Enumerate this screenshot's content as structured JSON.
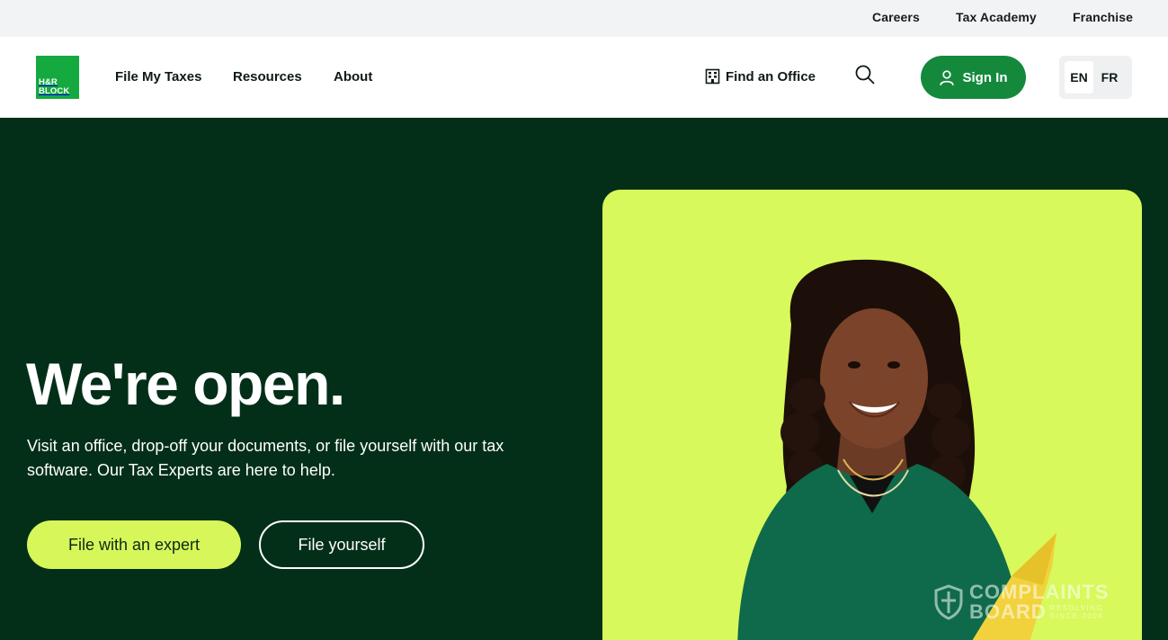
{
  "utility_nav": [
    "Careers",
    "Tax Academy",
    "Franchise"
  ],
  "brand": {
    "logo_line1": "H&R",
    "logo_line2": "BLOCK",
    "color": "#14aa40"
  },
  "main_nav": [
    "File My Taxes",
    "Resources",
    "About"
  ],
  "header": {
    "find_office": "Find an Office",
    "find_office_icon": "building-icon",
    "search_icon": "search-icon",
    "sign_in": "Sign In",
    "sign_in_icon": "user-icon"
  },
  "language": {
    "options": [
      "EN",
      "FR"
    ],
    "selected": "EN"
  },
  "hero": {
    "title": "We're open.",
    "subtitle": "Visit an office, drop-off your documents, or file yourself with our tax software. Our Tax Experts are here to help.",
    "primary_cta": "File with an expert",
    "secondary_cta": "File yourself"
  },
  "watermark": {
    "line1": "COMPLAINTS",
    "line2": "BOARD",
    "tag1": "RESOLVING",
    "tag2": "SINCE 2004"
  },
  "colors": {
    "hero_bg": "#032f18",
    "accent_lime": "#d7f65a",
    "signin_green": "#14893c",
    "utility_bg": "#f1f3f4"
  }
}
